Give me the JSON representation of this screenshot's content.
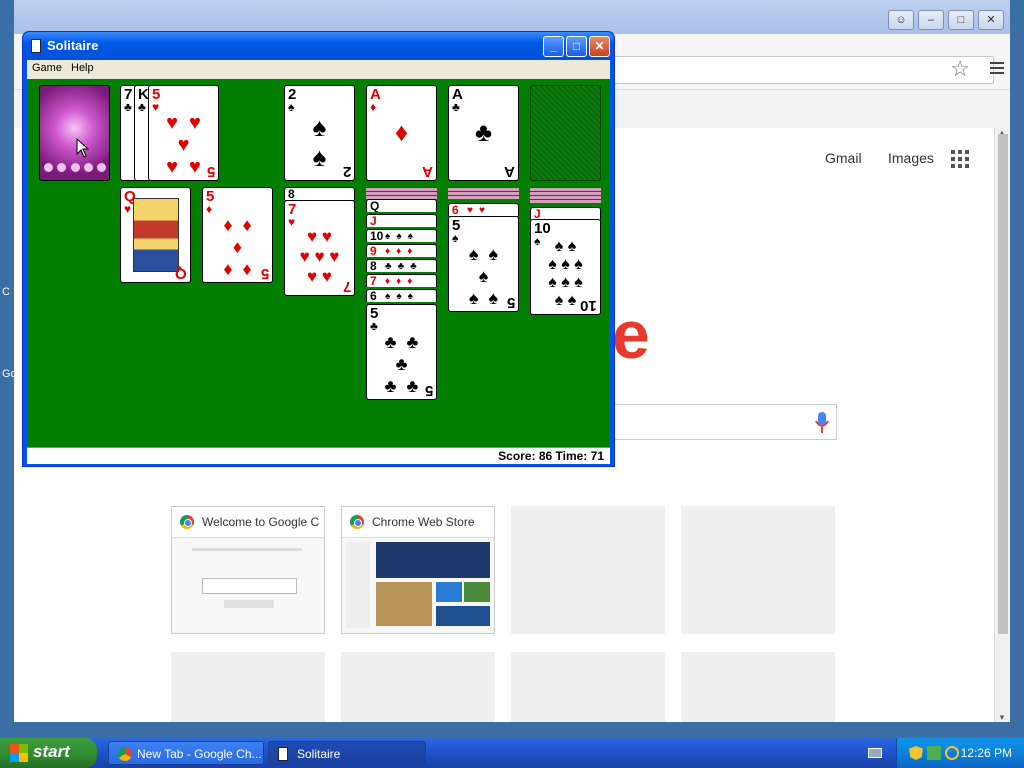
{
  "desktop": {
    "left_labels": [
      "C",
      "Go"
    ]
  },
  "chrome": {
    "header_links": {
      "gmail": "Gmail",
      "images": "Images"
    },
    "logo_fragment": "e",
    "tiles": [
      {
        "title": "Welcome to Google C"
      },
      {
        "title": "Chrome Web Store"
      },
      {
        "title": ""
      },
      {
        "title": ""
      },
      {
        "title": ""
      },
      {
        "title": ""
      },
      {
        "title": ""
      },
      {
        "title": ""
      }
    ]
  },
  "solitaire": {
    "title": "Solitaire",
    "menu": [
      "Game",
      "Help"
    ],
    "status": "Score: 86  Time: 71",
    "waste": [
      {
        "rank": "7",
        "suit": "♣",
        "color": "black"
      },
      {
        "rank": "K",
        "suit": "♣",
        "color": "black"
      },
      {
        "rank": "5",
        "suit": "♥",
        "color": "red"
      }
    ],
    "foundations": [
      {
        "rank": "2",
        "suit": "♠",
        "color": "black"
      },
      {
        "rank": "A",
        "suit": "♦",
        "color": "red"
      },
      {
        "rank": "A",
        "suit": "♣",
        "color": "black"
      }
    ],
    "tableau": [
      {
        "cards": [
          {
            "rank": "Q",
            "suit": "♥",
            "color": "red"
          }
        ]
      },
      {
        "cards": [
          {
            "rank": "5",
            "suit": "♦",
            "color": "red"
          }
        ]
      },
      {
        "cards": [
          {
            "rank": "8",
            "suit": "♠",
            "color": "black"
          },
          {
            "rank": "7",
            "suit": "♥",
            "color": "red"
          }
        ]
      },
      {
        "cards": [
          {
            "rank": "Q",
            "suit": "♠",
            "color": "black"
          },
          {
            "rank": "J",
            "suit": "♥",
            "color": "red"
          },
          {
            "rank": "10",
            "suit": "♠",
            "color": "black"
          },
          {
            "rank": "9",
            "suit": "♦",
            "color": "red"
          },
          {
            "rank": "8",
            "suit": "♣",
            "color": "black"
          },
          {
            "rank": "7",
            "suit": "♦",
            "color": "red"
          },
          {
            "rank": "6",
            "suit": "♠",
            "color": "black"
          },
          {
            "rank": "5",
            "suit": "♣",
            "color": "black"
          }
        ]
      },
      {
        "cards": [
          {
            "rank": "6",
            "suit": "♥",
            "color": "red"
          },
          {
            "rank": "5",
            "suit": "♠",
            "color": "black"
          }
        ]
      },
      {
        "cards": [
          {
            "rank": "J",
            "suit": "♥",
            "color": "red"
          },
          {
            "rank": "10",
            "suit": "♠",
            "color": "black"
          }
        ]
      }
    ]
  },
  "taskbar": {
    "start_label": "start",
    "buttons": [
      {
        "label": "New Tab - Google Ch...",
        "icon": "chrome-icon"
      },
      {
        "label": "Solitaire",
        "icon": "solitaire-icon"
      }
    ],
    "clock": "12:26 PM"
  }
}
